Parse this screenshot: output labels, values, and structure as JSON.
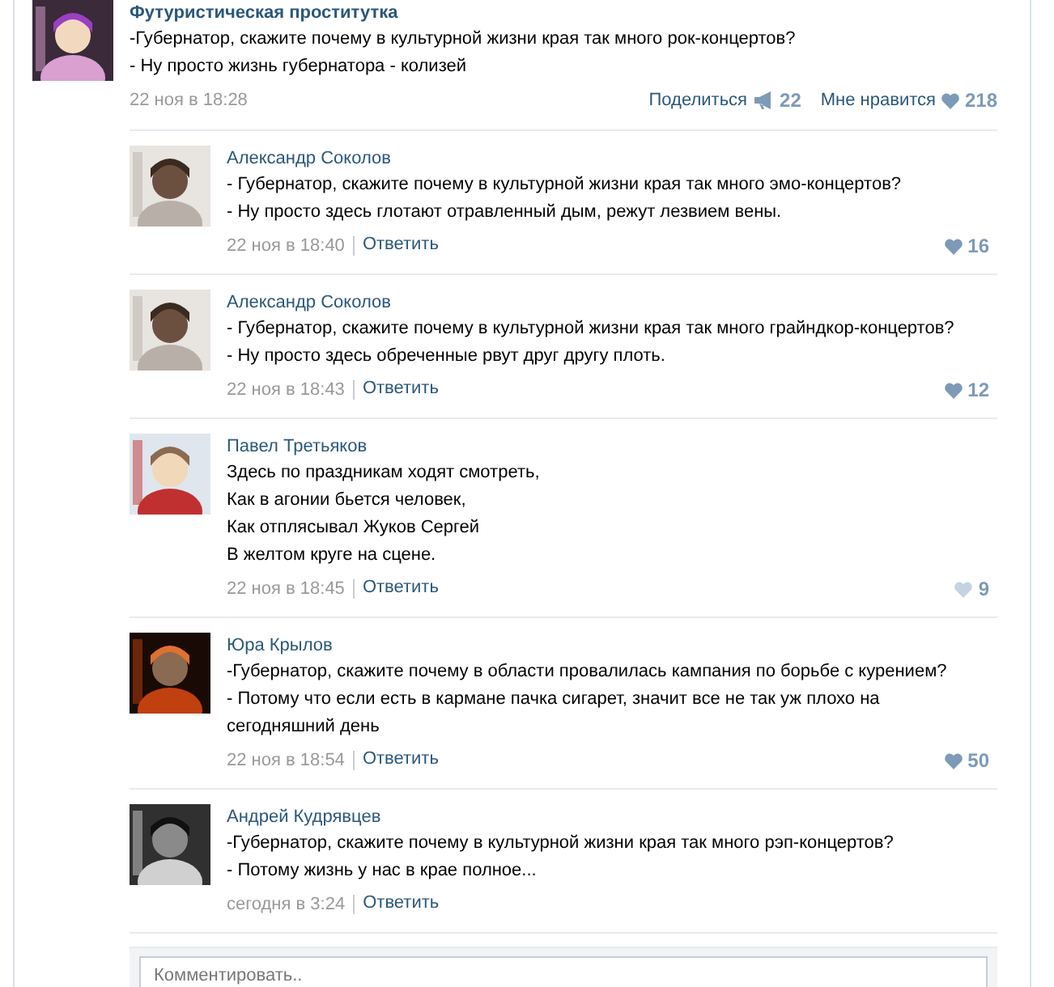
{
  "post": {
    "author": "Футуристическая проститутка",
    "lines": [
      "-Губернатор, скажите почему в культурной жизни края так много рок-концертов?",
      "- Ну просто жизнь губернатора - колизей"
    ],
    "date": "22 ноя в 18:28",
    "share_label": "Поделиться",
    "share_count": "22",
    "like_label": "Мне нравится",
    "like_count": "218"
  },
  "comments": [
    {
      "author": "Александр Соколов",
      "lines": [
        "- Губернатор, скажите почему в культурной жизни края так много эмо-концертов?",
        "- Ну просто здесь глотают отравленный дым, режут лезвием вены."
      ],
      "date": "22 ноя в 18:40",
      "reply": "Ответить",
      "likes": "16",
      "liked": true
    },
    {
      "author": "Александр Соколов",
      "lines": [
        "- Губернатор, скажите почему в культурной жизни края так много грайндкор-концертов?",
        "- Ну просто здесь обреченные рвут друг другу плоть."
      ],
      "date": "22 ноя в 18:43",
      "reply": "Ответить",
      "likes": "12",
      "liked": true
    },
    {
      "author": "Павел Третьяков",
      "lines": [
        "Здесь по праздникам ходят смотреть,",
        "Как в агонии бьется человек,",
        "Как отплясывал Жуков Сергей",
        "В желтом круге на сцене."
      ],
      "date": "22 ноя в 18:45",
      "reply": "Ответить",
      "likes": "9",
      "liked": false
    },
    {
      "author": "Юра Крылов",
      "lines": [
        "-Губернатор, скажите почему в области провалилась кампания по борьбе с курением?",
        "- Потому что если есть в кармане пачка сигарет, значит все не так уж плохо на сегодняшний день"
      ],
      "date": "22 ноя в 18:54",
      "reply": "Ответить",
      "likes": "50",
      "liked": true
    },
    {
      "author": "Андрей Кудрявцев",
      "lines": [
        "-Губернатор, скажите почему в культурной жизни края так много рэп-концертов?",
        "- Потому жизнь у нас в крае полное..."
      ],
      "date": "сегодня в 3:24",
      "reply": "Ответить"
    }
  ],
  "comment_field": {
    "placeholder": "Комментировать.."
  }
}
